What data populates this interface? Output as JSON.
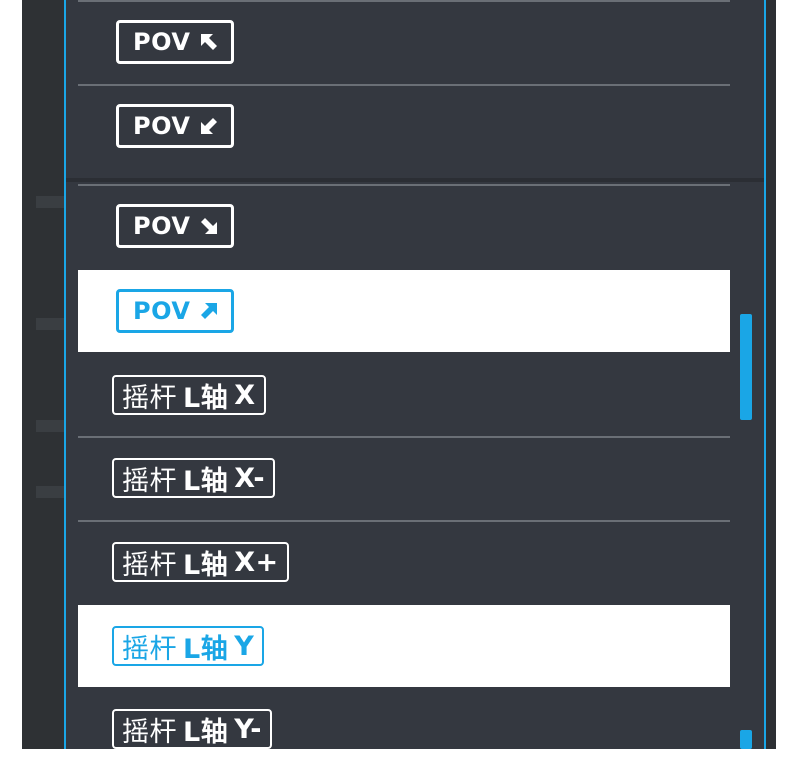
{
  "colors": {
    "panel": "#343840",
    "accent": "#1aa6e6",
    "separator": "#6a6f76",
    "selected_bg": "#ffffff"
  },
  "items": [
    {
      "prefix": "POV",
      "icon": "arrow-up-left-icon"
    },
    {
      "prefix": "POV",
      "icon": "arrow-down-left-icon"
    },
    {
      "prefix": "POV",
      "icon": "arrow-down-right-icon"
    },
    {
      "prefix": "POV",
      "icon": "arrow-up-right-icon",
      "selected": true
    },
    {
      "cn": "摇杆",
      "axis": "L轴",
      "dir": "X"
    },
    {
      "cn": "摇杆",
      "axis": "L轴",
      "dir": "X-"
    },
    {
      "cn": "摇杆",
      "axis": "L轴",
      "dir": "X+"
    },
    {
      "cn": "摇杆",
      "axis": "L轴",
      "dir": "Y",
      "selected": true
    },
    {
      "cn": "摇杆",
      "axis": "L轴",
      "dir": "Y-"
    }
  ]
}
